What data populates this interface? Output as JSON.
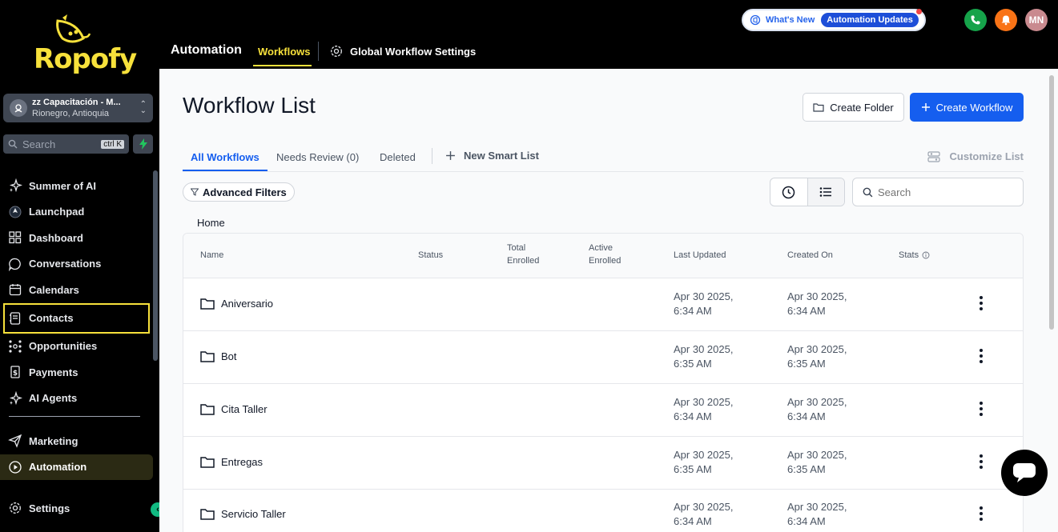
{
  "brand": {
    "name": "Ropofy",
    "accent": "#f7e13b"
  },
  "account": {
    "name": "zz Capacitación - M...",
    "location": "Rionegro, Antioquia"
  },
  "sidebar_search": {
    "placeholder": "Search",
    "shortcut": "ctrl K"
  },
  "nav": [
    {
      "label": "Summer of AI",
      "icon": "sparkle-icon"
    },
    {
      "label": "Launchpad",
      "icon": "rocket-icon"
    },
    {
      "label": "Dashboard",
      "icon": "grid-icon"
    },
    {
      "label": "Conversations",
      "icon": "chat-icon"
    },
    {
      "label": "Calendars",
      "icon": "calendar-icon"
    },
    {
      "label": "Contacts",
      "icon": "contacts-icon"
    },
    {
      "label": "Opportunities",
      "icon": "network-icon"
    },
    {
      "label": "Payments",
      "icon": "receipt-icon"
    },
    {
      "label": "AI Agents",
      "icon": "sparkle-icon"
    }
  ],
  "nav2": [
    {
      "label": "Marketing",
      "icon": "send-icon"
    },
    {
      "label": "Automation",
      "icon": "play-circle-icon"
    }
  ],
  "settings_label": "Settings",
  "topbar": {
    "whats_new": "What's New",
    "updates_pill": "Automation Updates",
    "avatar_initials": "MN",
    "title": "Automation",
    "tab_workflows": "Workflows",
    "tab_global_settings": "Global Workflow Settings"
  },
  "main": {
    "title": "Workflow List",
    "create_folder": "Create Folder",
    "create_workflow": "Create Workflow",
    "tabs": {
      "all": "All Workflows",
      "needs_review": "Needs Review (0)",
      "deleted": "Deleted",
      "new_smart_list": "New Smart List",
      "customize": "Customize List"
    },
    "advanced_filters": "Advanced Filters",
    "search_placeholder": "Search",
    "breadcrumb": "Home",
    "columns": {
      "name": "Name",
      "status": "Status",
      "total_enrolled_1": "Total",
      "total_enrolled_2": "Enrolled",
      "active_enrolled_1": "Active",
      "active_enrolled_2": "Enrolled",
      "last_updated": "Last Updated",
      "created_on": "Created On",
      "stats": "Stats"
    },
    "rows": [
      {
        "name": "Aniversario",
        "updated_1": "Apr 30 2025,",
        "updated_2": "6:34 AM",
        "created_1": "Apr 30 2025,",
        "created_2": "6:34 AM"
      },
      {
        "name": "Bot",
        "updated_1": "Apr 30 2025,",
        "updated_2": "6:35 AM",
        "created_1": "Apr 30 2025,",
        "created_2": "6:35 AM"
      },
      {
        "name": "Cita Taller",
        "updated_1": "Apr 30 2025,",
        "updated_2": "6:34 AM",
        "created_1": "Apr 30 2025,",
        "created_2": "6:34 AM"
      },
      {
        "name": "Entregas",
        "updated_1": "Apr 30 2025,",
        "updated_2": "6:35 AM",
        "created_1": "Apr 30 2025,",
        "created_2": "6:35 AM"
      },
      {
        "name": "Servicio Taller",
        "updated_1": "Apr 30 2025,",
        "updated_2": "6:34 AM",
        "created_1": "Apr 30 2025,",
        "created_2": "6:34 AM"
      }
    ]
  }
}
